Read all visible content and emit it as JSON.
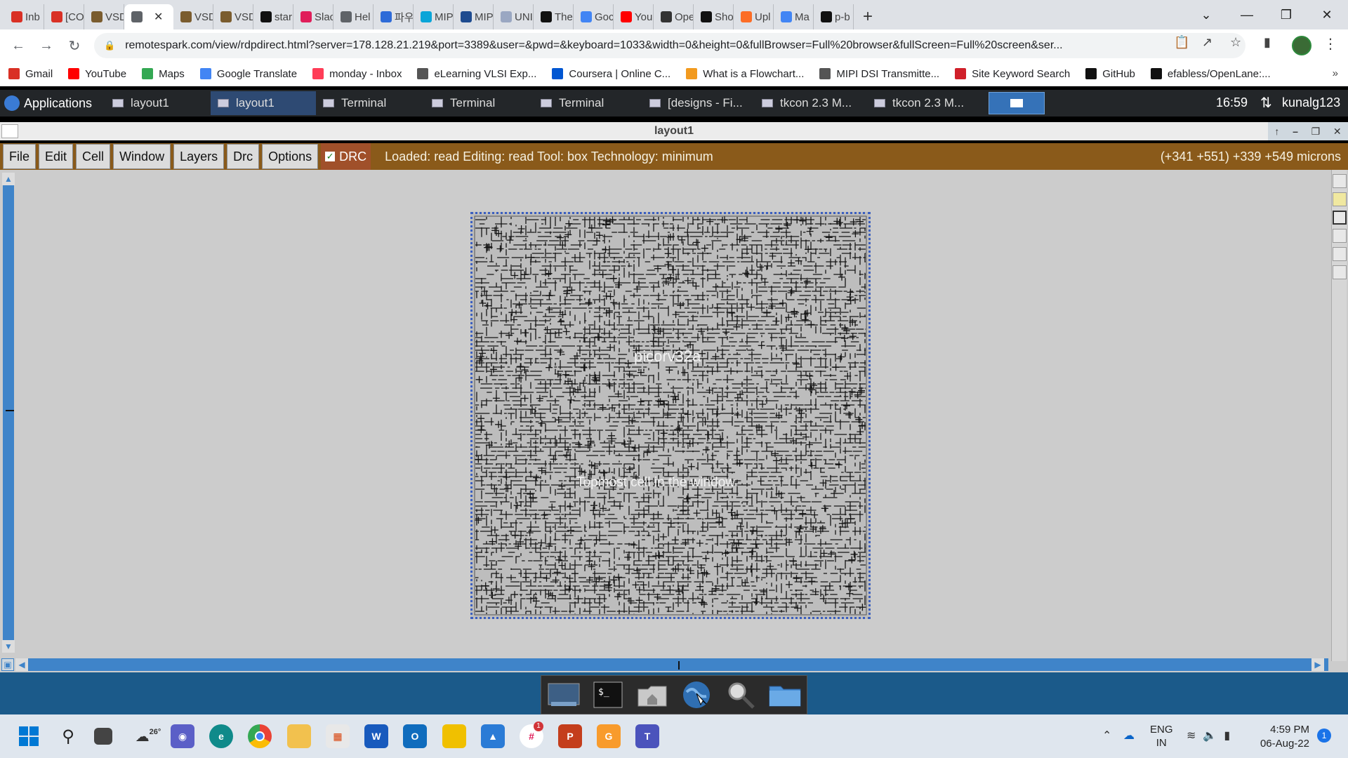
{
  "browser": {
    "tabs": [
      {
        "label": "Inb",
        "icon": "gmail-icon",
        "color": "#d93025"
      },
      {
        "label": "[CO",
        "icon": "gmail-icon",
        "color": "#d93025"
      },
      {
        "label": "VSD",
        "icon": "vsd-icon",
        "color": "#7a5c2e"
      },
      {
        "label": "",
        "icon": "globe-icon",
        "color": "#5f6368",
        "active": true
      },
      {
        "label": "VSD",
        "icon": "vsd-icon",
        "color": "#7a5c2e"
      },
      {
        "label": "VSD",
        "icon": "vsd-icon",
        "color": "#7a5c2e"
      },
      {
        "label": "star",
        "icon": "github-icon",
        "color": "#111111"
      },
      {
        "label": "Slac",
        "icon": "slack-icon",
        "color": "#e01e5a"
      },
      {
        "label": "Hel",
        "icon": "globe-icon",
        "color": "#5f6368"
      },
      {
        "label": "파우",
        "icon": "papago-icon",
        "color": "#2e6bd8"
      },
      {
        "label": "MIP",
        "icon": "coursera-icon",
        "color": "#0aa5d8"
      },
      {
        "label": "MIP",
        "icon": "mipi-icon",
        "color": "#1e4b8f"
      },
      {
        "label": "UNI",
        "icon": "uni-icon",
        "color": "#9aa7c2"
      },
      {
        "label": "The",
        "icon": "github-icon",
        "color": "#111111"
      },
      {
        "label": "Goc",
        "icon": "google-translate-icon",
        "color": "#4285f4"
      },
      {
        "label": "You",
        "icon": "youtube-icon",
        "color": "#ff0000"
      },
      {
        "label": "Ope",
        "icon": "doc-icon",
        "color": "#333333"
      },
      {
        "label": "Sho",
        "icon": "github-icon",
        "color": "#111111"
      },
      {
        "label": "Upl",
        "icon": "gitlab-icon",
        "color": "#fc6d26"
      },
      {
        "label": "Ma",
        "icon": "g-icon",
        "color": "#4285f4"
      },
      {
        "label": "p-b",
        "icon": "github-icon",
        "color": "#111111"
      }
    ],
    "url": "remotespark.com/view/rdpdirect.html?server=178.128.21.219&port=3389&user=&pwd=&keyboard=1033&width=0&height=0&fullBrowser=Full%20browser&fullScreen=Full%20screen&ser...",
    "bookmarks": [
      {
        "label": "Gmail",
        "icon": "gmail-icon",
        "color": "#d93025"
      },
      {
        "label": "YouTube",
        "icon": "youtube-icon",
        "color": "#ff0000"
      },
      {
        "label": "Maps",
        "icon": "maps-icon",
        "color": "#34a853"
      },
      {
        "label": "Google Translate",
        "icon": "google-translate-icon",
        "color": "#4285f4"
      },
      {
        "label": "monday - Inbox",
        "icon": "monday-icon",
        "color": "#ff3d57"
      },
      {
        "label": "eLearning VLSI Exp...",
        "icon": "elearning-icon",
        "color": "#555555"
      },
      {
        "label": "Coursera | Online C...",
        "icon": "coursera-icon",
        "color": "#0056d2"
      },
      {
        "label": "What is a Flowchart...",
        "icon": "flowchart-icon",
        "color": "#f29a1f"
      },
      {
        "label": "MIPI DSI Transmitte...",
        "icon": "mipi-icon",
        "color": "#555555"
      },
      {
        "label": "Site Keyword Search",
        "icon": "keyword-icon",
        "color": "#d0202a"
      },
      {
        "label": "GitHub",
        "icon": "github-icon",
        "color": "#111111"
      },
      {
        "label": "efabless/OpenLane:...",
        "icon": "github-icon",
        "color": "#111111"
      }
    ],
    "more": "»"
  },
  "xfce_panel": {
    "apps_label": "Applications",
    "tasks": [
      {
        "label": "layout1",
        "active": false
      },
      {
        "label": "layout1",
        "active": true
      },
      {
        "label": "Terminal",
        "active": false
      },
      {
        "label": "Terminal",
        "active": false
      },
      {
        "label": "Terminal",
        "active": false
      },
      {
        "label": "[designs - Fi...",
        "active": false
      },
      {
        "label": "tkcon 2.3 M...",
        "active": false
      },
      {
        "label": "tkcon 2.3 M...",
        "active": false
      }
    ],
    "clock": "16:59",
    "user": "kunalg123"
  },
  "magic": {
    "title": "layout1",
    "menus": [
      "File",
      "Edit",
      "Cell",
      "Window",
      "Layers",
      "Drc",
      "Options"
    ],
    "drc_label": "DRC",
    "status": "Loaded: read Editing: read Tool: box  Technology: minimum",
    "coords": "(+341 +551) +339 +549 microns",
    "cell_label_1": "picorv32a",
    "cell_label_2": "Topmost cell in the window",
    "accent": "#8a5a1a"
  },
  "taskbar": {
    "weather": "26°",
    "lang_top": "ENG",
    "lang_bottom": "IN",
    "time": "4:59 PM",
    "date": "06-Aug-22",
    "notif_count": "1",
    "chrome_badge": "1"
  }
}
